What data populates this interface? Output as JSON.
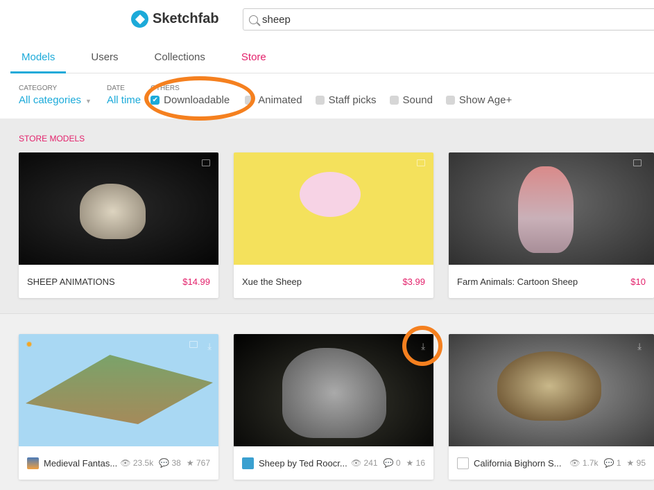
{
  "brand": "Sketchfab",
  "search": {
    "value": "sheep"
  },
  "tabs": [
    "Models",
    "Users",
    "Collections",
    "Store"
  ],
  "filters": {
    "category": {
      "label": "CATEGORY",
      "value": "All categories"
    },
    "date": {
      "label": "DATE",
      "value": "All time"
    },
    "others_label": "OTHERS",
    "checks": [
      {
        "label": "Downloadable",
        "checked": true
      },
      {
        "label": "Animated",
        "checked": false
      },
      {
        "label": "Staff picks",
        "checked": false
      },
      {
        "label": "Sound",
        "checked": false
      },
      {
        "label": "Show Age+",
        "checked": false
      }
    ]
  },
  "store": {
    "title": "STORE MODELS",
    "items": [
      {
        "name": "SHEEP ANIMATIONS",
        "price": "$14.99"
      },
      {
        "name": "Xue the Sheep",
        "price": "$3.99"
      },
      {
        "name": "Farm Animals: Cartoon Sheep",
        "price": "$10"
      }
    ]
  },
  "models": [
    {
      "name": "Medieval Fantas...",
      "views": "23.5k",
      "comments": "38",
      "likes": "767"
    },
    {
      "name": "Sheep by Ted Roocr...",
      "views": "241",
      "comments": "0",
      "likes": "16"
    },
    {
      "name": "California Bighorn S...",
      "views": "1.7k",
      "comments": "1",
      "likes": "95"
    }
  ],
  "icons": {
    "view": "👁",
    "comment": "💬",
    "like": "★",
    "download": "⤓"
  }
}
